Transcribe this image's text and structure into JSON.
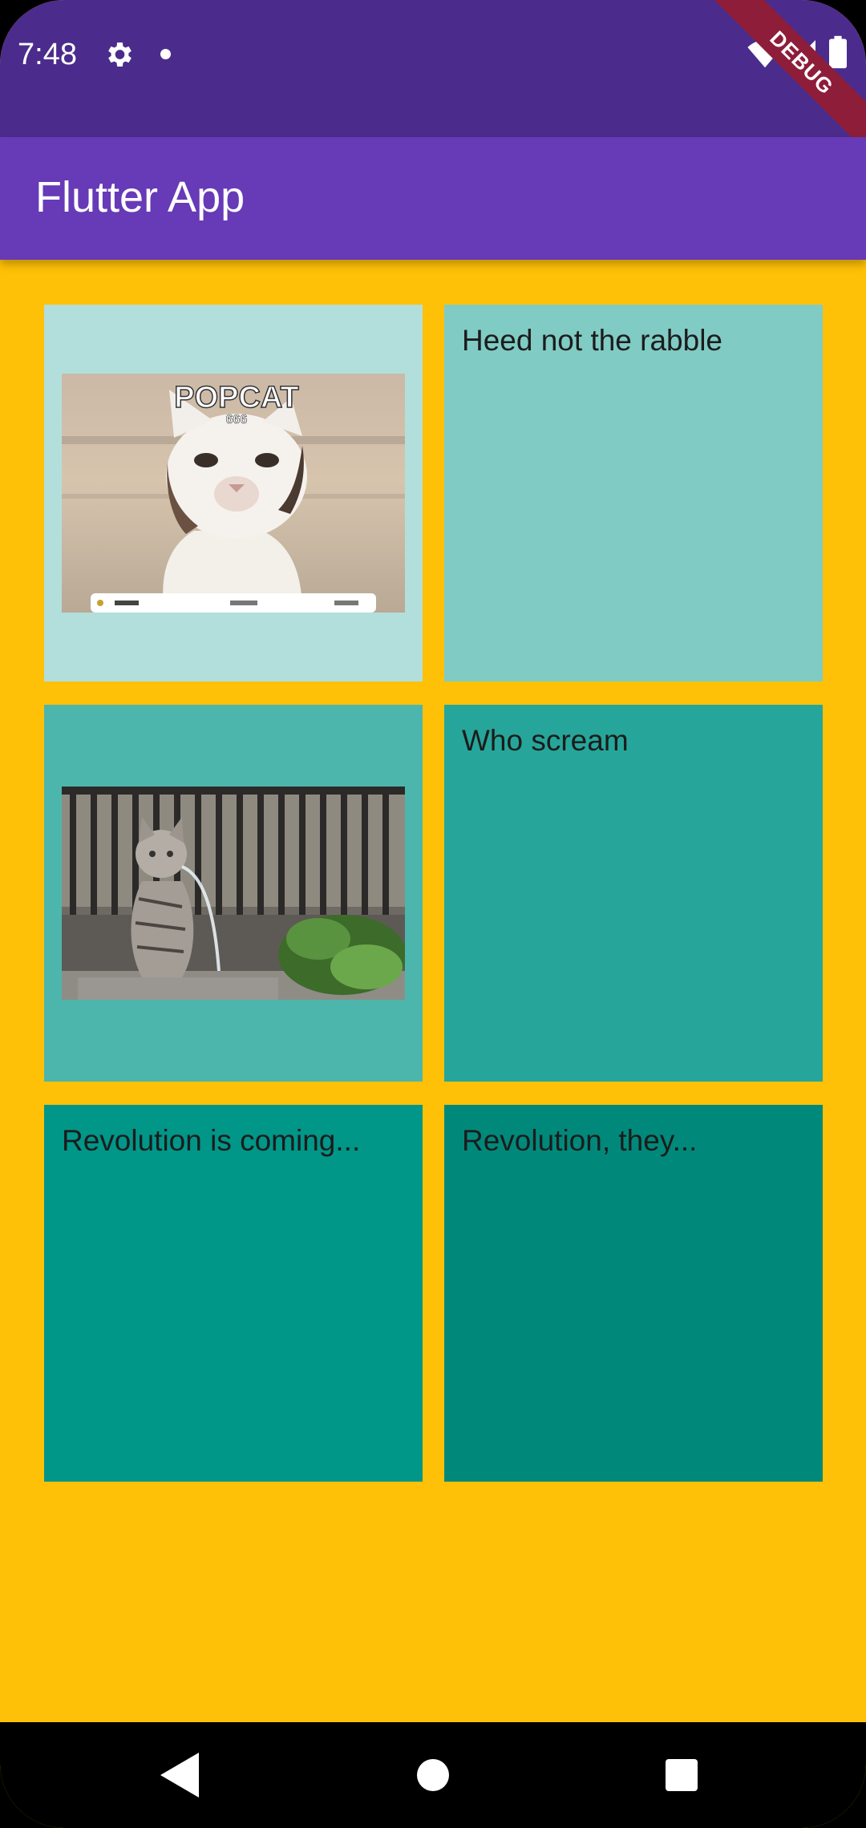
{
  "status_bar": {
    "time": "7:48",
    "debug_label": "DEBUG",
    "icons": [
      "gear-icon",
      "notification-dot-icon",
      "wifi-icon",
      "signal-icon",
      "battery-icon"
    ]
  },
  "app_bar": {
    "title": "Flutter App"
  },
  "grid": {
    "tiles": [
      {
        "kind": "image",
        "image": "popcat-meme",
        "color": "#B2DFDB",
        "overlay_title": "POPCAT",
        "overlay_count": "666"
      },
      {
        "kind": "text",
        "text": "Heed not the rabble",
        "color": "#80CBC4"
      },
      {
        "kind": "image",
        "image": "cat-statue-fountain",
        "color": "#4DB6AC"
      },
      {
        "kind": "text",
        "text": "Who scream",
        "color": "#26A69A"
      },
      {
        "kind": "text",
        "text": "Revolution is coming...",
        "color": "#009688"
      },
      {
        "kind": "text",
        "text": "Revolution, they...",
        "color": "#00897B"
      }
    ],
    "background": "#FFC107"
  },
  "nav_bar": {
    "icons": [
      "back-icon",
      "home-icon",
      "recents-icon"
    ]
  }
}
